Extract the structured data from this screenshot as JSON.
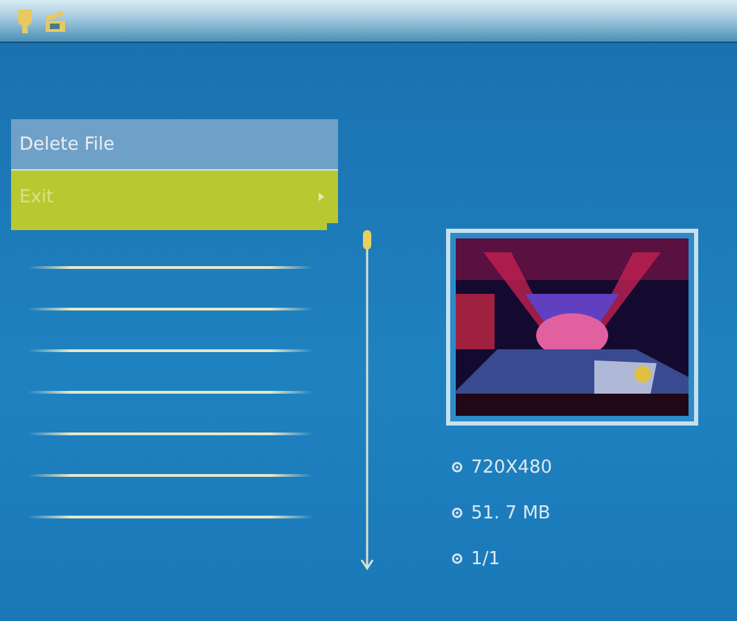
{
  "file_list": {
    "rows": [
      {
        "selected": true
      },
      {
        "selected": false
      },
      {
        "selected": false
      },
      {
        "selected": false
      },
      {
        "selected": false
      },
      {
        "selected": false
      },
      {
        "selected": false
      },
      {
        "selected": false
      }
    ]
  },
  "menu": {
    "items": [
      {
        "label": "Delete File",
        "selected": false,
        "submenu": false
      },
      {
        "label": "Exit",
        "selected": true,
        "submenu": true
      }
    ]
  },
  "info": [
    "720X480",
    "51. 7 MB",
    "1/1"
  ]
}
